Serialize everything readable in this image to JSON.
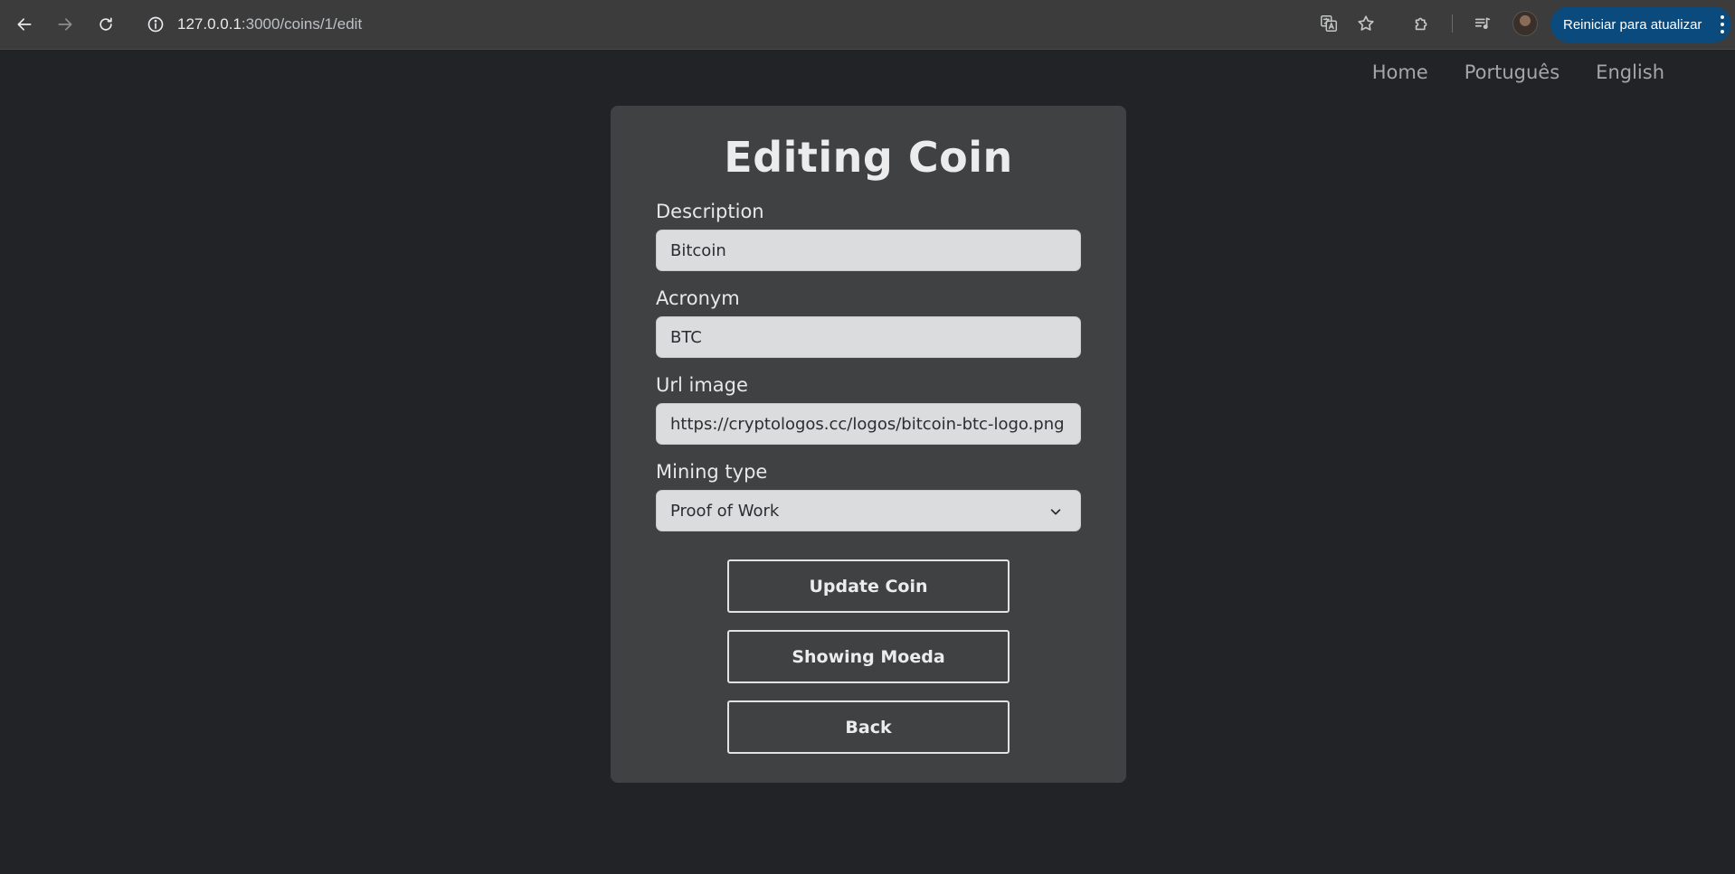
{
  "browser": {
    "url_host": "127.0.0.1",
    "url_path": ":3000/coins/1/edit",
    "update_button_label": "Reiniciar para atualizar",
    "icons": [
      "back-arrow-icon",
      "forward-arrow-icon",
      "reload-icon",
      "info-icon",
      "translate-icon",
      "star-icon",
      "extensions-icon",
      "media-queue-icon",
      "profile-avatar",
      "kebab-menu-icon"
    ]
  },
  "nav": {
    "items": [
      {
        "label": "Home"
      },
      {
        "label": "Português"
      },
      {
        "label": "English"
      }
    ]
  },
  "form": {
    "title": "Editing Coin",
    "fields": {
      "description": {
        "label": "Description",
        "value": "Bitcoin"
      },
      "acronym": {
        "label": "Acronym",
        "value": "BTC"
      },
      "url_image": {
        "label": "Url image",
        "value": "https://cryptologos.cc/logos/bitcoin-btc-logo.png"
      },
      "mining_type": {
        "label": "Mining type",
        "selected": "Proof of Work"
      }
    },
    "buttons": {
      "update": "Update Coin",
      "show": "Showing Moeda",
      "back": "Back"
    }
  },
  "colors": {
    "page_background": "#212327",
    "card_background": "#404143",
    "input_background": "#dadcdd",
    "update_pill": "#0b4a7d"
  }
}
